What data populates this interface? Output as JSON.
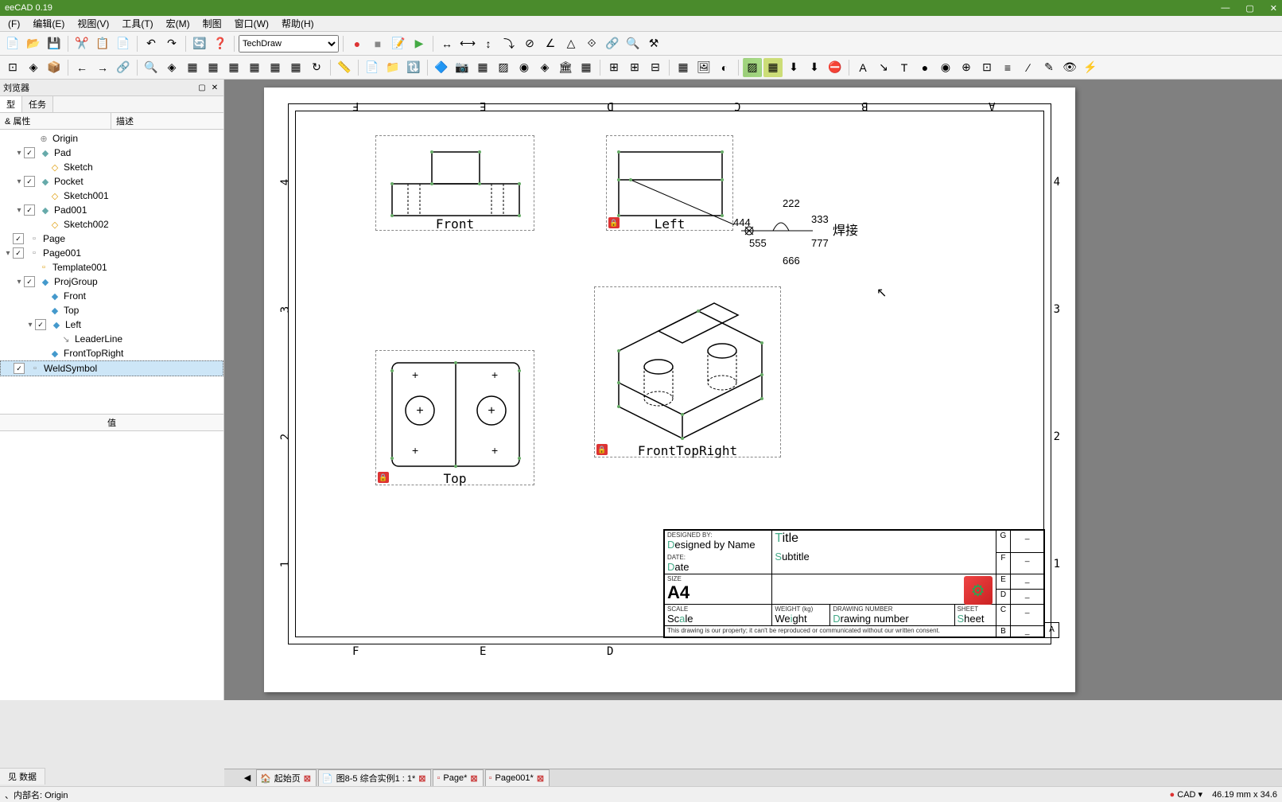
{
  "app": {
    "title": "eeCAD 0.19"
  },
  "menu": {
    "file": "(F)",
    "edit": "编辑(E)",
    "view": "视图(V)",
    "tools": "工具(T)",
    "macro": "宏(M)",
    "draw": "制图",
    "window": "窗口(W)",
    "help": "帮助(H)"
  },
  "workbench": {
    "selected": "TechDraw"
  },
  "panel": {
    "title": "刘览器",
    "tab_model": "型",
    "tab_task": "任务",
    "col_labels": "& 属性",
    "col_desc": "描述",
    "prop_col_value": "值"
  },
  "tree": [
    {
      "indent": 2,
      "exp": "",
      "chk": false,
      "label": "Origin",
      "icon": "⊕"
    },
    {
      "indent": 1,
      "exp": "▾",
      "chk": true,
      "label": "Pad",
      "icon": "◆",
      "color": "#6aa"
    },
    {
      "indent": 3,
      "exp": "",
      "chk": false,
      "label": "Sketch",
      "icon": "◇",
      "color": "#d90"
    },
    {
      "indent": 1,
      "exp": "▾",
      "chk": true,
      "label": "Pocket",
      "icon": "◆",
      "color": "#6aa"
    },
    {
      "indent": 3,
      "exp": "",
      "chk": false,
      "label": "Sketch001",
      "icon": "◇",
      "color": "#d90"
    },
    {
      "indent": 1,
      "exp": "▾",
      "chk": true,
      "label": "Pad001",
      "icon": "◆",
      "color": "#6aa"
    },
    {
      "indent": 3,
      "exp": "",
      "chk": false,
      "label": "Sketch002",
      "icon": "◇",
      "color": "#d90"
    },
    {
      "indent": 0,
      "exp": "",
      "chk": true,
      "label": "Page",
      "icon": "▫"
    },
    {
      "indent": 0,
      "exp": "▾",
      "chk": true,
      "label": "Page001",
      "icon": "▫"
    },
    {
      "indent": 2,
      "exp": "",
      "chk": false,
      "label": "Template001",
      "icon": "▫",
      "color": "#d90"
    },
    {
      "indent": 1,
      "exp": "▾",
      "chk": true,
      "label": "ProjGroup",
      "icon": "◆",
      "color": "#49c"
    },
    {
      "indent": 3,
      "exp": "",
      "chk": false,
      "label": "Front",
      "icon": "◆",
      "color": "#49c"
    },
    {
      "indent": 3,
      "exp": "",
      "chk": false,
      "label": "Top",
      "icon": "◆",
      "color": "#49c"
    },
    {
      "indent": 2,
      "exp": "▾",
      "chk": true,
      "label": "Left",
      "icon": "◆",
      "color": "#49c"
    },
    {
      "indent": 4,
      "exp": "",
      "chk": false,
      "label": "LeaderLine",
      "icon": "↘"
    },
    {
      "indent": 3,
      "exp": "",
      "chk": false,
      "label": "FrontTopRight",
      "icon": "◆",
      "color": "#49c"
    },
    {
      "indent": 0,
      "exp": "",
      "chk": true,
      "label": "WeldSymbol",
      "icon": "▫",
      "selected": true
    }
  ],
  "views": {
    "front": "Front",
    "left": "Left",
    "top": "Top",
    "ftr": "FrontTopRight"
  },
  "weld": {
    "n1": "222",
    "n2": "333",
    "n3": "444",
    "n4": "555",
    "n5": "666",
    "n6": "777",
    "tail": "焊接"
  },
  "titleblock": {
    "designed_by_lbl": "DESIGNED BY:",
    "designed_by": "Designed by Name",
    "date_lbl": "DATE:",
    "date": "Date",
    "size_lbl": "SIZE",
    "size": "A4",
    "title": "Title",
    "subtitle": "Subtitle",
    "scale_lbl": "SCALE",
    "scale": "Scale",
    "weight_lbl": "WEIGHT (kg)",
    "weight": "Weight",
    "drawing_num_lbl": "DRAWING NUMBER",
    "drawing_num": "Drawing number",
    "sheet_lbl": "SHEET",
    "sheet": "Sheet",
    "rev": [
      "G",
      "F",
      "E",
      "D",
      "C",
      "B",
      "A"
    ],
    "rev_dash": "_",
    "disclaimer": "This drawing is our property; it can't be reproduced or communicated without our written consent."
  },
  "coords": {
    "top": [
      "F",
      "E",
      "D",
      "C",
      "B",
      "A"
    ],
    "bot": [
      "F",
      "E",
      "D"
    ],
    "left": [
      "4",
      "3",
      "2",
      "1"
    ],
    "right": [
      "4",
      "3",
      "2",
      "1"
    ]
  },
  "doc_tabs": [
    {
      "label": "起始页",
      "close": true,
      "icon": "🏠"
    },
    {
      "label": "图8-5 综合实例1 : 1*",
      "close": true,
      "icon": "📄"
    },
    {
      "label": "Page*",
      "close": true,
      "icon": "▫"
    },
    {
      "label": "Page001*",
      "close": true,
      "icon": "▫"
    }
  ],
  "bottom_sidebar_tabs": {
    "view": "视图",
    "data": "数据"
  },
  "status": {
    "left": "、内部名: Origin",
    "cad": "CAD",
    "coords": "46.19 mm x 34.6"
  }
}
